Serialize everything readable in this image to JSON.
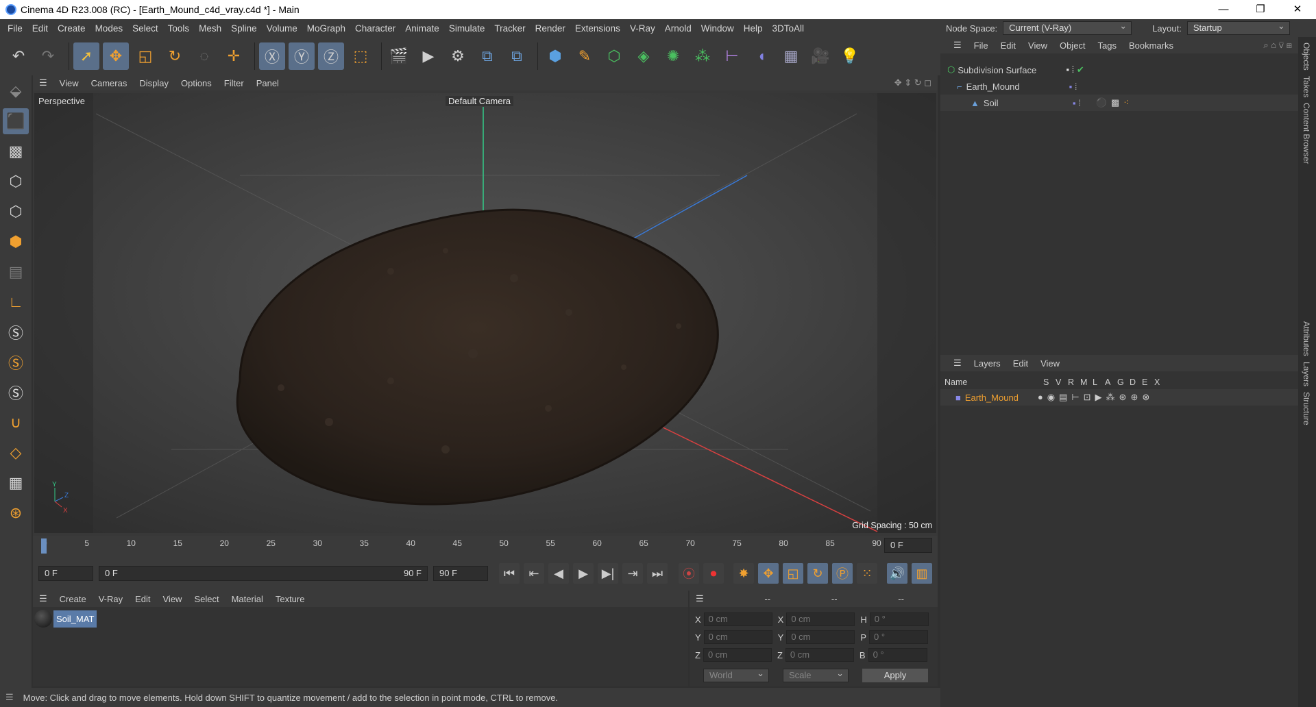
{
  "window": {
    "title": "Cinema 4D R23.008 (RC) - [Earth_Mound_c4d_vray.c4d *] - Main",
    "min": "—",
    "max": "❐",
    "close": "✕"
  },
  "menu": [
    "File",
    "Edit",
    "Create",
    "Modes",
    "Select",
    "Tools",
    "Mesh",
    "Spline",
    "Volume",
    "MoGraph",
    "Character",
    "Animate",
    "Simulate",
    "Tracker",
    "Render",
    "Extensions",
    "V-Ray",
    "Arnold",
    "Window",
    "Help",
    "3DToAll"
  ],
  "nodespace": {
    "label": "Node Space:",
    "value": "Current (V-Ray)"
  },
  "layout": {
    "label": "Layout:",
    "value": "Startup"
  },
  "viewport": {
    "menu": [
      "View",
      "Cameras",
      "Display",
      "Options",
      "Filter",
      "Panel"
    ],
    "name": "Perspective",
    "camera": "Default Camera",
    "grid": "Grid Spacing : 50 cm"
  },
  "timeline": {
    "ticks": [
      "0",
      "5",
      "10",
      "15",
      "20",
      "25",
      "30",
      "35",
      "40",
      "45",
      "50",
      "55",
      "60",
      "65",
      "70",
      "75",
      "80",
      "85",
      "90"
    ],
    "current": "0 F"
  },
  "frames": {
    "start": "0 F",
    "range_start": "0 F",
    "range_end": "90 F",
    "end": "90 F"
  },
  "materials": {
    "menu": [
      "Create",
      "V-Ray",
      "Edit",
      "View",
      "Select",
      "Material",
      "Texture"
    ],
    "items": [
      {
        "name": "Soil_MAT"
      }
    ]
  },
  "coords": {
    "headers": [
      "--",
      "--",
      "--"
    ],
    "rows": [
      {
        "a": "X",
        "av": "0 cm",
        "b": "X",
        "bv": "0 cm",
        "c": "H",
        "cv": "0 °"
      },
      {
        "a": "Y",
        "av": "0 cm",
        "b": "Y",
        "bv": "0 cm",
        "c": "P",
        "cv": "0 °"
      },
      {
        "a": "Z",
        "av": "0 cm",
        "b": "Z",
        "bv": "0 cm",
        "c": "B",
        "cv": "0 °"
      }
    ],
    "world": "World",
    "scale": "Scale",
    "apply": "Apply"
  },
  "status": "Move: Click and drag to move elements. Hold down SHIFT to quantize movement / add to the selection in point mode, CTRL to remove.",
  "objects": {
    "menu": [
      "File",
      "Edit",
      "View",
      "Object",
      "Tags",
      "Bookmarks"
    ],
    "items": [
      {
        "name": "Subdivision Surface"
      },
      {
        "name": "Earth_Mound"
      },
      {
        "name": "Soil"
      }
    ]
  },
  "layers": {
    "menu": [
      "Layers",
      "Edit",
      "View"
    ],
    "header": "Name",
    "cols": [
      "S",
      "V",
      "R",
      "M",
      "L",
      "A",
      "G",
      "D",
      "E",
      "X"
    ],
    "items": [
      {
        "name": "Earth_Mound"
      }
    ]
  },
  "vtabs": [
    "Objects",
    "Takes",
    "Content Browser",
    "Attributes",
    "Layers",
    "Structure"
  ]
}
